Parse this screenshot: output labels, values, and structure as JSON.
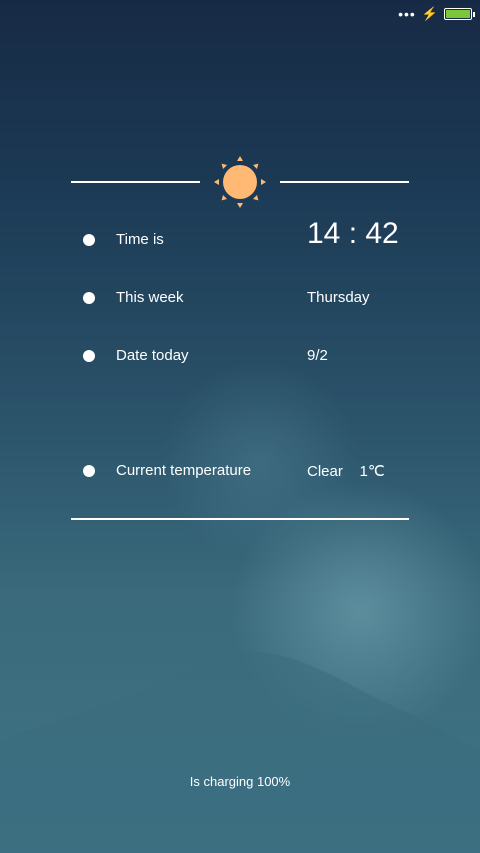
{
  "status_bar": {
    "overflow_icon": "more-dots-icon",
    "charging_icon": "lightning-bolt-icon",
    "battery_level_percent": 100,
    "battery_color": "#7cc63a"
  },
  "header": {
    "icon": "sun-icon",
    "icon_color": "#ffb974"
  },
  "rows": [
    {
      "label": "Time is",
      "value": "14 : 42"
    },
    {
      "label": "This week",
      "value": "Thursday"
    },
    {
      "label": "Date today",
      "value": "9/2"
    },
    {
      "label": "Current temperature",
      "value": "Clear    1℃"
    }
  ],
  "footer": {
    "charging_text": "Is charging 100%"
  }
}
